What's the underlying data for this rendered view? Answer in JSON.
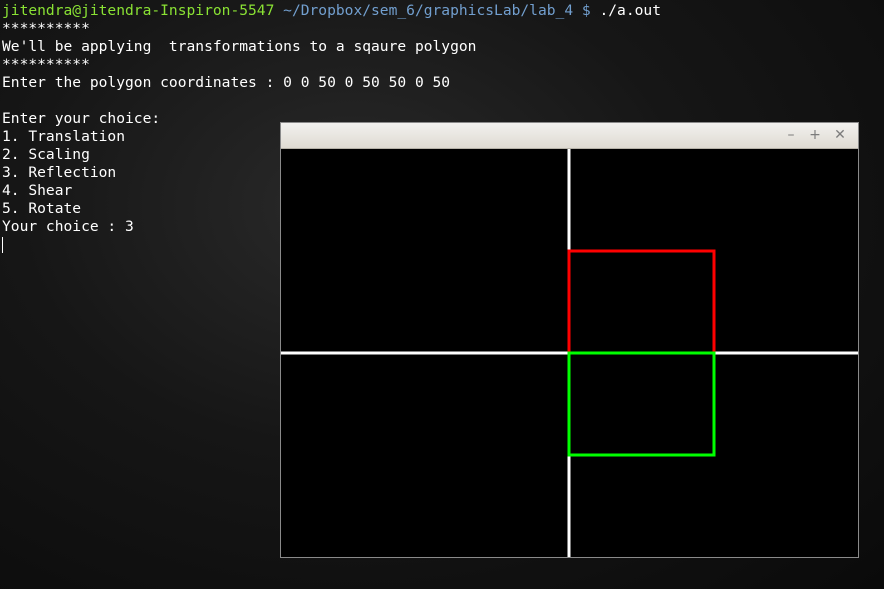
{
  "terminal": {
    "prompt_user": "jitendra@jitendra-Inspiron-5547",
    "prompt_path": " ~/Dropbox/sem_6/graphicsLab/lab_4 $",
    "command": " ./a.out",
    "lines": [
      "**********",
      "We'll be applying  transformations to a sqaure polygon",
      "**********",
      "Enter the polygon coordinates : 0 0 50 0 50 50 0 50",
      "",
      "Enter your choice:",
      "1. Translation",
      "2. Scaling",
      "3. Reflection",
      "4. Shear",
      "5. Rotate",
      "Your choice : 3"
    ]
  },
  "graphics_window": {
    "controls": {
      "minimize": "–",
      "maximize": "+",
      "close": "✕"
    },
    "colors": {
      "background": "#000000",
      "axes": "#ffffff",
      "original": "#ff0000",
      "reflected": "#00ff00"
    }
  }
}
